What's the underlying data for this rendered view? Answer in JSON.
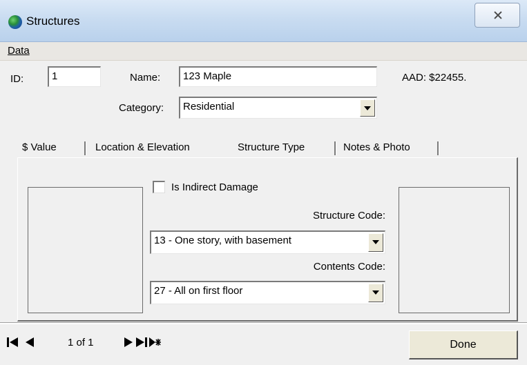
{
  "window": {
    "title": "Structures"
  },
  "menu": {
    "data_label": "Data"
  },
  "header": {
    "id_label": "ID:",
    "id_value": "1",
    "name_label": "Name:",
    "name_value": "123 Maple",
    "aad_text": "AAD: $22455.",
    "category_label": "Category:",
    "category_value": "Residential"
  },
  "tabs": [
    {
      "label": "$ Value"
    },
    {
      "label": "Location & Elevation"
    },
    {
      "label": "Structure Type",
      "active": true
    },
    {
      "label": "Notes & Photo"
    }
  ],
  "structure_type": {
    "indirect_damage_label": "Is Indirect Damage",
    "indirect_damage_checked": false,
    "structure_code_label": "Structure Code:",
    "structure_code_value": "13 - One story, with basement",
    "contents_code_label": "Contents Code:",
    "contents_code_value": "27 - All on first floor"
  },
  "navigator": {
    "position_text": "1 of 1"
  },
  "actions": {
    "done_label": "Done"
  }
}
